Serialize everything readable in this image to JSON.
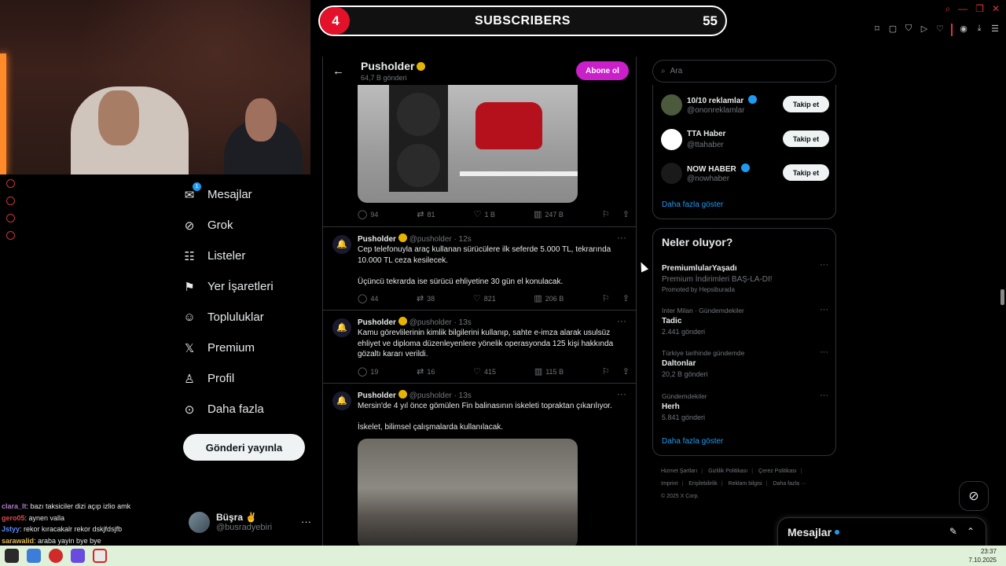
{
  "subscriber_goal": {
    "current": "4",
    "title": "SUBSCRIBERS",
    "target": "55",
    "progress_fraction": 0.073
  },
  "nav": {
    "items": [
      {
        "label": "Mesajlar",
        "icon": "envelope-icon",
        "badge": "1"
      },
      {
        "label": "Grok",
        "icon": "grok-icon"
      },
      {
        "label": "Listeler",
        "icon": "list-icon"
      },
      {
        "label": "Yer İşaretleri",
        "icon": "bookmark-icon"
      },
      {
        "label": "Topluluklar",
        "icon": "people-icon"
      },
      {
        "label": "Premium",
        "icon": "x-logo-icon"
      },
      {
        "label": "Profil",
        "icon": "person-icon"
      },
      {
        "label": "Daha fazla",
        "icon": "more-circle-icon"
      }
    ],
    "post_button": "Gönderi yayınla"
  },
  "profile": {
    "name": "Büşra ✌",
    "handle": "@busradyebiri"
  },
  "chat": [
    {
      "user": "clara_lt",
      "text": ": bazı taksiciler dizi açıp izlio amk",
      "color": "#b07cc6"
    },
    {
      "user": "gero05",
      "text": ": aynen valla",
      "color": "#d94a4a"
    },
    {
      "user": "Jstyy",
      "text": ": rekor kıracakalr rekor dskjfdsjfb",
      "color": "#5b8cff"
    },
    {
      "user": "sarawalid",
      "text": ": araba yayin bye bye",
      "color": "#e0b84a"
    }
  ],
  "timeline": {
    "title": "Pusholder",
    "subtitle": "64,7 B gönderi",
    "subscribe_button": "Abone ol",
    "first_actions": {
      "replies": "94",
      "reposts": "81",
      "likes": "1 B",
      "views": "247 B"
    },
    "tweets": [
      {
        "name": "Pusholder",
        "handle": "@pusholder",
        "time": "12s",
        "lines": [
          "Cep telefonuyla araç kullanan sürücülere ilk seferde 5.000 TL, tekrarında",
          "10.000 TL ceza kesilecek.",
          "",
          "Üçüncü tekrarda ise sürücü ehliyetine 30 gün el konulacak."
        ],
        "actions": {
          "replies": "44",
          "reposts": "38",
          "likes": "821",
          "views": "206 B"
        }
      },
      {
        "name": "Pusholder",
        "handle": "@pusholder",
        "time": "13s",
        "lines": [
          "Kamu görevlilerinin kimlik bilgilerini kullanıp, sahte e-imza alarak usulsüz",
          "ehliyet ve diploma düzenleyenlere yönelik operasyonda 125 kişi hakkında",
          "gözaltı kararı verildi."
        ],
        "actions": {
          "replies": "19",
          "reposts": "16",
          "likes": "415",
          "views": "115 B"
        }
      },
      {
        "name": "Pusholder",
        "handle": "@pusholder",
        "time": "13s",
        "lines": [
          "Mersin'de 4 yıl önce gömülen Fin balinasının iskeleti topraktan çıkarılıyor.",
          "",
          "İskelet, bilimsel çalışmalarda kullanılacak."
        ]
      }
    ]
  },
  "right": {
    "search_placeholder": "Ara",
    "follow_suggestions": [
      {
        "name": "10/10 reklamlar",
        "handle": "@ononreklamlar",
        "button": "Takip et",
        "avatar_color": "#4b5a3c"
      },
      {
        "name": "TTA Haber",
        "handle": "@ttahaber",
        "button": "Takip et",
        "avatar_color": "#ffffff"
      },
      {
        "name": "NOW HABER",
        "handle": "@nowhaber",
        "button": "Takip et",
        "avatar_color": "#1a1a1a"
      }
    ],
    "show_more": "Daha fazla göster",
    "trends_title": "Neler oluyor?",
    "trends": [
      {
        "category": "",
        "name": "PremiumlularYaşadı",
        "sub": "Premium İndirimleri BAŞ-LA-DI!",
        "sub2": "Promoted by Hepsiburada"
      },
      {
        "category": "Inter Milan · Gündemdekiler",
        "name": "Tadic",
        "sub": "2.441 gönderi"
      },
      {
        "category": "Türkiye tarihinde gündemde",
        "name": "Daltonlar",
        "sub": "20,2 B gönderi"
      },
      {
        "category": "Gündemdekiler",
        "name": "Herh",
        "sub": "5.841 gönderi"
      }
    ],
    "trends_more": "Daha fazla göster",
    "footer": [
      "Hizmet Şartları",
      "Gizlilik Politikası",
      "Çerez Politikası",
      "Imprint",
      "Erişilebilirlik",
      "Reklam bilgisi",
      "Daha fazla ···",
      "© 2025 X Corp."
    ]
  },
  "messages_dock": {
    "title": "Mesajlar"
  },
  "taskbar": {
    "time": "23:37",
    "date": "7.10.2025"
  }
}
